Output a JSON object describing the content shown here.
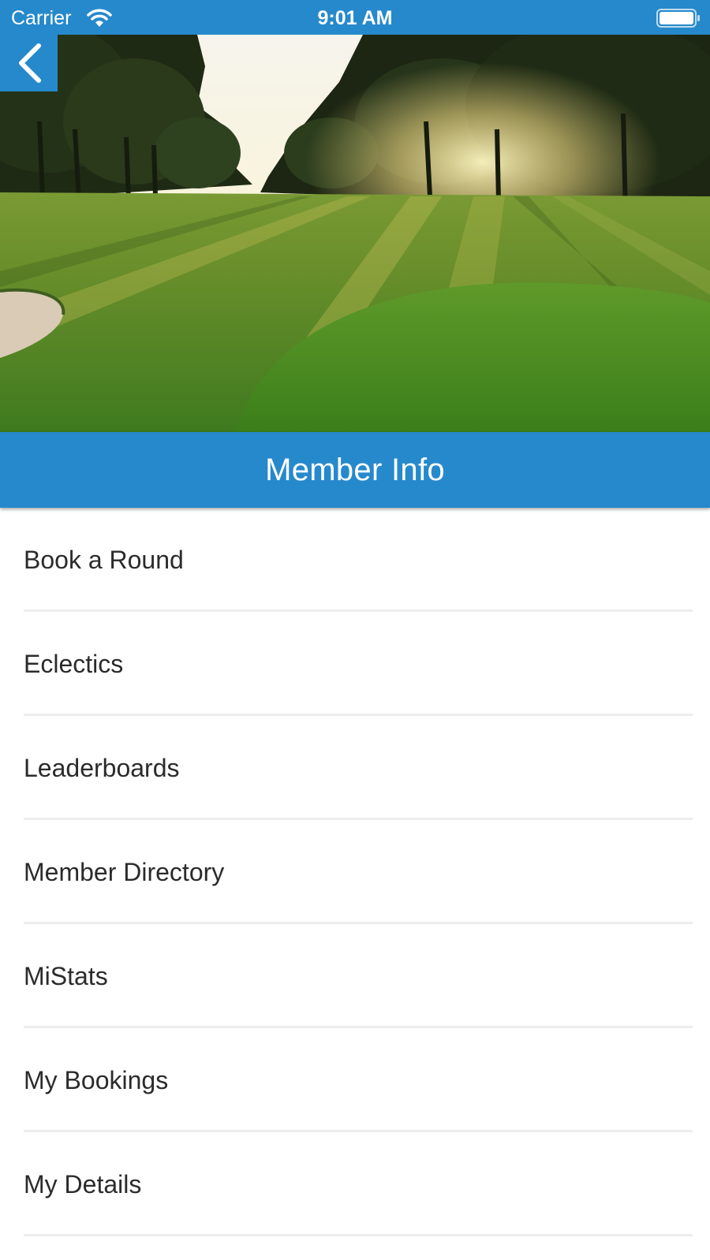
{
  "status_bar": {
    "carrier": "Carrier",
    "time": "9:01 AM",
    "wifi_icon": "wifi-icon",
    "battery_icon": "battery-full-icon"
  },
  "navigation": {
    "back_icon": "chevron-left-icon"
  },
  "hero": {
    "image": "golf-course-fairway-at-sunrise"
  },
  "header": {
    "title": "Member Info"
  },
  "menu": {
    "items": [
      {
        "label": "Book a Round"
      },
      {
        "label": "Eclectics"
      },
      {
        "label": "Leaderboards"
      },
      {
        "label": "Member Directory"
      },
      {
        "label": "MiStats"
      },
      {
        "label": "My Bookings"
      },
      {
        "label": "My Details"
      }
    ]
  },
  "colors": {
    "accent": "#2689cc",
    "text": "#2b2b2b",
    "divider": "#ededed",
    "background": "#ffffff"
  }
}
